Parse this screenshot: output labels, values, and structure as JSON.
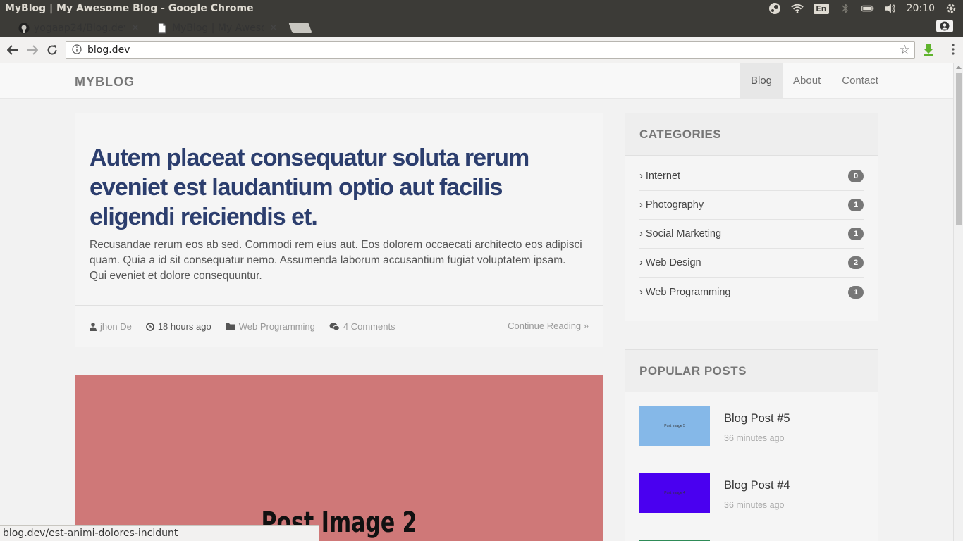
{
  "os": {
    "window_title": "MyBlog | My Awesome Blog - Google Chrome",
    "keyboard_layout": "En",
    "clock": "20:10"
  },
  "browser": {
    "tabs": [
      {
        "title": "yogaap24/Blog.dev",
        "active": false,
        "icon": "github-icon"
      },
      {
        "title": "MyBlog | My Awesome Blog",
        "active": true,
        "icon": "page-icon"
      }
    ],
    "url": "blog.dev",
    "status_url": "blog.dev/est-animi-dolores-incidunt"
  },
  "site": {
    "brand": "MYBLOG",
    "nav": [
      {
        "label": "Blog",
        "active": true
      },
      {
        "label": "About",
        "active": false
      },
      {
        "label": "Contact",
        "active": false
      }
    ]
  },
  "post": {
    "title": "Autem placeat consequatur soluta rerum eveniet est laudantium optio aut facilis eligendi reiciendis et.",
    "excerpt": "Recusandae rerum eos ab sed. Commodi rem eius aut. Eos dolorem occaecati architecto eos adipisci quam. Quia a id sit consequatur nemo. Assumenda laborum accusantium fugiat voluptatem ipsam. Qui eveniet et dolore consequuntur.",
    "author": "jhon De",
    "time": "18 hours ago",
    "category": "Web Programming",
    "comments": "4 Comments",
    "continue": "Continue Reading »"
  },
  "post2": {
    "image_text": "Post Image 2",
    "image_color": "#cf7878"
  },
  "categories": {
    "heading": "CATEGORIES",
    "items": [
      {
        "name": "Internet",
        "count": "0"
      },
      {
        "name": "Photography",
        "count": "1"
      },
      {
        "name": "Social Marketing",
        "count": "1"
      },
      {
        "name": "Web Design",
        "count": "2"
      },
      {
        "name": "Web Programming",
        "count": "1"
      }
    ]
  },
  "popular": {
    "heading": "POPULAR POSTS",
    "items": [
      {
        "title": "Blog Post #5",
        "time": "36 minutes ago",
        "thumb_text": "Post Image 5",
        "thumb_color": "#85b8e8"
      },
      {
        "title": "Blog Post #4",
        "time": "36 minutes ago",
        "thumb_text": "Post Image 4",
        "thumb_color": "#4a00f0"
      }
    ]
  }
}
